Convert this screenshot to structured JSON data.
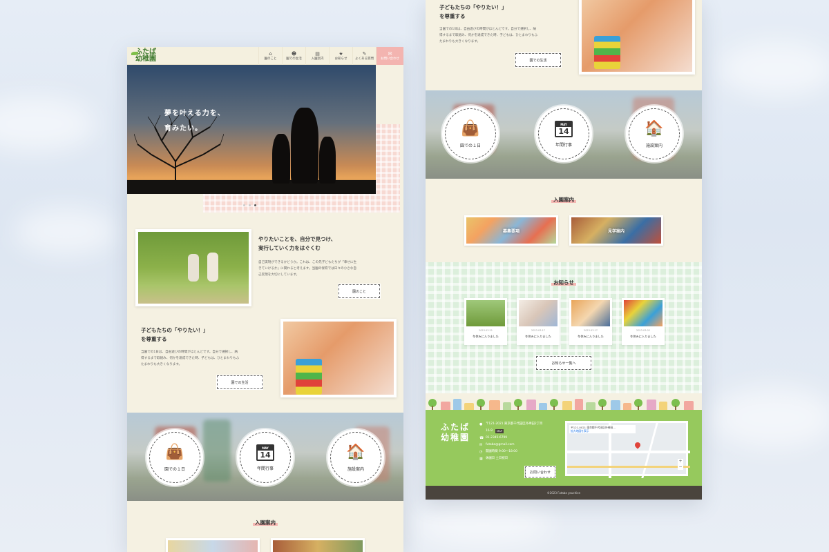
{
  "site": {
    "logo_line1": "ふたば",
    "logo_line2": "幼稚園"
  },
  "nav": [
    {
      "icon": "⌂",
      "label": "園のこと"
    },
    {
      "icon": "☻",
      "label": "園での生活"
    },
    {
      "icon": "▤",
      "label": "入園案内"
    },
    {
      "icon": "★",
      "label": "お知らせ"
    },
    {
      "icon": "✎",
      "label": "よくある質問"
    },
    {
      "icon": "✉",
      "label": "お問い合わせ"
    }
  ],
  "hero": {
    "line1": "夢を叶える力を、",
    "line2": "育みたい。"
  },
  "about": {
    "title1": "やりたいことを、自分で見つけ、",
    "title2": "実行していく力をはぐくむ",
    "p1": "自己実現ができるかどうか。これは、この先子どもたちが「幸せに生",
    "p2": "きていけるか」に関わると考えます。当園の保育では日々の小さな自",
    "p3": "己実現を大切にしています。",
    "button": "園のこと"
  },
  "life": {
    "title1": "子どもたちの「やりたい！」",
    "title2": "を尊重する",
    "p1": "当園での1日は、自由遊びの時間がほとんどです。自分で選択し、納",
    "p2": "得するまで取組み、何かを達成できた時、子どもは、ひとまわりもふ",
    "p3": "たまわりも大きくなります。",
    "button": "園での生活"
  },
  "circles": [
    {
      "icon": "bag-icon",
      "label": "園での１日"
    },
    {
      "icon": "calendar-icon",
      "label": "年間行事",
      "month": "MAY",
      "day": "14"
    },
    {
      "icon": "house-icon",
      "label": "施設案内"
    }
  ],
  "admission": {
    "heading": "入園案内",
    "cards": [
      "募集要項",
      "見学案内"
    ]
  },
  "news": {
    "heading": "お知らせ",
    "items": [
      {
        "date": "2023.03.21",
        "title": "冬休みに入りました"
      },
      {
        "date": "2023.03.17",
        "title": "冬休みに入りました"
      },
      {
        "date": "2023.03.17",
        "title": "冬休みに入りました"
      },
      {
        "date": "2023.03.02",
        "title": "冬休みに入りました"
      }
    ],
    "button": "お知らせ一覧へ"
  },
  "footer": {
    "logo_line1": "ふたば",
    "logo_line2": "幼稚園",
    "address1": "〒121-2021 東京都千代田区外神田2丁目",
    "address2": "16-9",
    "map_tag": "MAP",
    "phone": "01-2345-6799",
    "email": "futaba@gmail.com",
    "hours": "開園時間 9:00～18:00",
    "holiday": "休園日 土日祝日",
    "contact_button": "お問い合わせ",
    "map_label1": "〒121-0021 東京都千代田区外神田...",
    "map_label2": "拡大地図を表示",
    "copyright": "©2023 Futaba youchien"
  },
  "colors": {
    "cream": "#f5f1e2",
    "pink": "#f3b4b0",
    "green": "#96c95d",
    "dark": "#4a443d"
  }
}
